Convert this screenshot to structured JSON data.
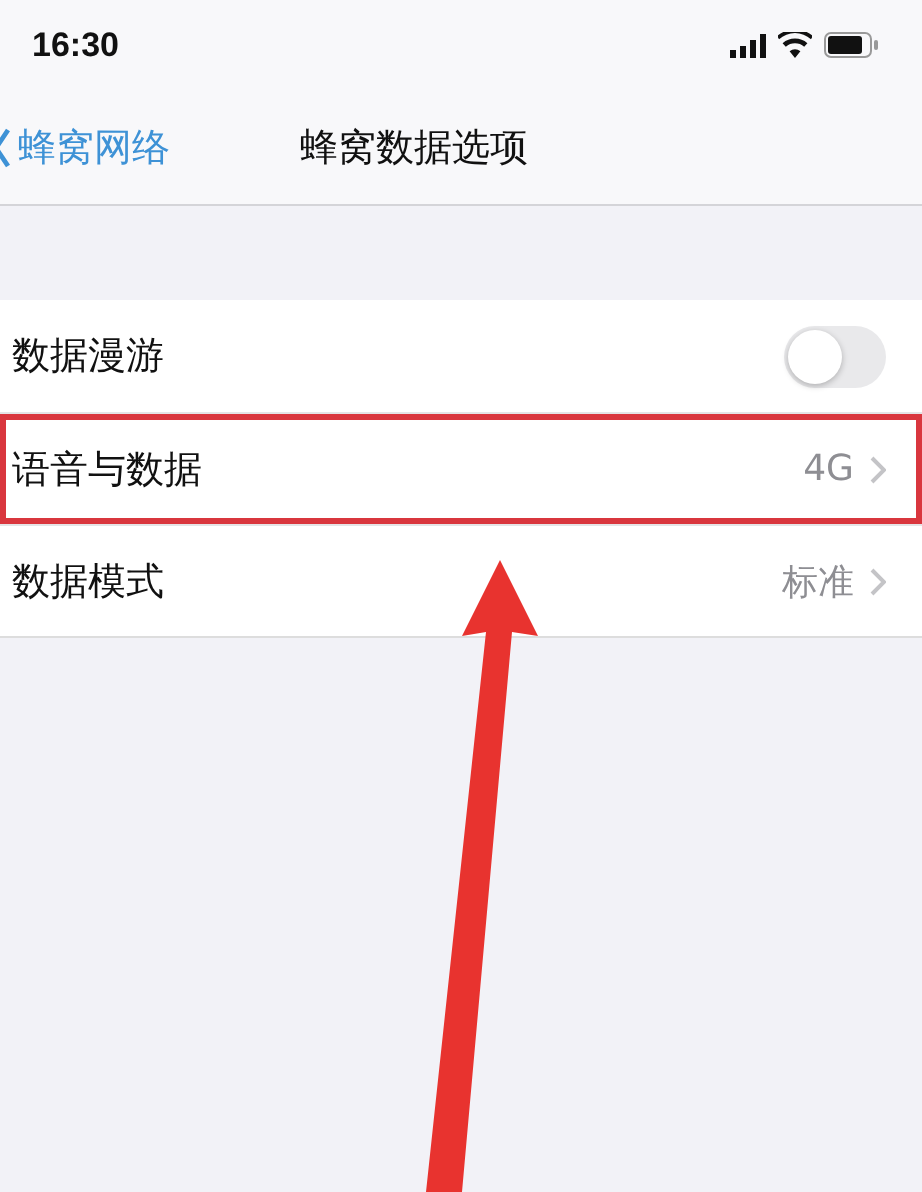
{
  "status_bar": {
    "time": "16:30"
  },
  "nav": {
    "back_label": "蜂窝网络",
    "title": "蜂窝数据选项"
  },
  "rows": [
    {
      "kind": "toggle",
      "label": "数据漫游",
      "on": false,
      "highlighted": false
    },
    {
      "kind": "disclosure",
      "label": "语音与数据",
      "value": "4G",
      "highlighted": true
    },
    {
      "kind": "disclosure",
      "label": "数据模式",
      "value": "标准",
      "highlighted": false
    }
  ],
  "annotation": {
    "arrow": true
  }
}
